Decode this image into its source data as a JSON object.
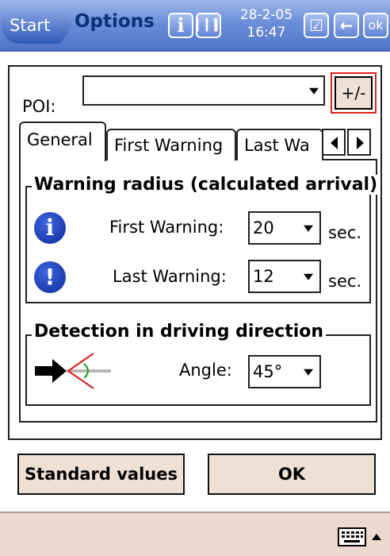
{
  "titlebar": {
    "start_label": "Start",
    "app_title": "Options",
    "date": "28-2-05",
    "time": "16:47",
    "ok_label": "ok",
    "info_icon": "info-icon",
    "signal_icon": "signal-strength-icon",
    "checklist_icon": "checklist-icon",
    "back_icon": "back-arrow-icon"
  },
  "poi": {
    "label": "POI:",
    "selected": "",
    "toggle_label": "+/-"
  },
  "tabs": [
    {
      "label": "General",
      "active": true
    },
    {
      "label": "First Warning",
      "active": false
    },
    {
      "label": "Last Wa",
      "active": false
    }
  ],
  "warning_radius": {
    "title": "Warning radius (calculated arrival)",
    "first_label": "First Warning:",
    "first_value": "20",
    "first_unit": "sec.",
    "last_label": "Last Warning:",
    "last_value": "12",
    "last_unit": "sec."
  },
  "detection": {
    "title": "Detection in driving direction",
    "angle_label": "Angle:",
    "angle_value": "45°"
  },
  "buttons": {
    "standard_label": "Standard values",
    "ok_label": "OK"
  },
  "colors": {
    "titlebar": "#6c8fd9",
    "button_bg": "#efe0d4",
    "highlight_border": "#e0241b",
    "icon_blue": "#0b2a9a"
  }
}
